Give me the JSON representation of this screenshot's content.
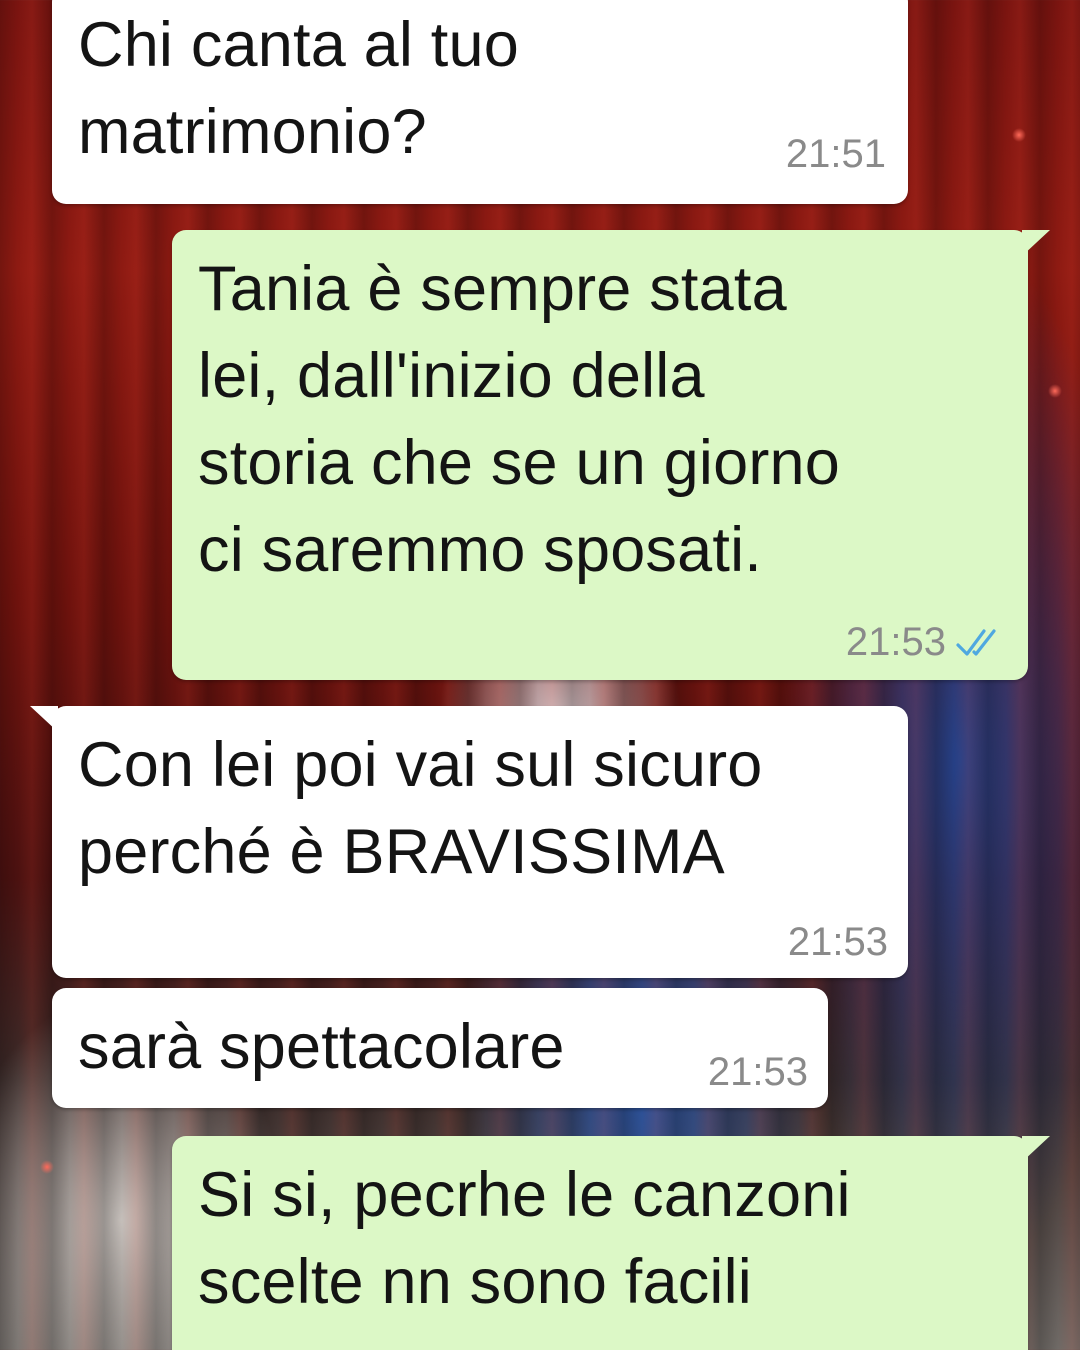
{
  "theme": {
    "incoming_bubble": "#ffffff",
    "outgoing_bubble": "#dcf8c6",
    "read_tick_color": "#4fa8e0"
  },
  "messages": [
    {
      "direction": "incoming",
      "text": "Chi canta al tuo\nmatrimonio?",
      "time": "21:51"
    },
    {
      "direction": "outgoing",
      "text": "Tania è sempre stata\nlei, dall'inizio della\nstoria che se un giorno\nci saremmo sposati.",
      "time": "21:53",
      "status_icon": "double-check-read-icon"
    },
    {
      "direction": "incoming",
      "text": "Con lei poi vai sul sicuro\nperché è BRAVISSIMA",
      "time": "21:53"
    },
    {
      "direction": "incoming",
      "text": "sarà spettacolare",
      "time": "21:53"
    },
    {
      "direction": "outgoing",
      "text": "Si si, pecrhe le canzoni\nscelte nn sono facili"
    }
  ]
}
